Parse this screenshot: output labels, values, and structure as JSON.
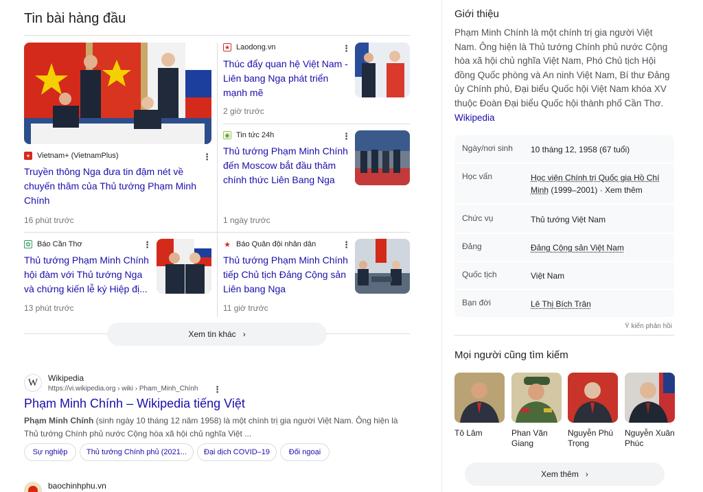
{
  "top_stories": {
    "heading": "Tin bài hàng đầu",
    "featured": {
      "source": "Vietnam+ (VietnamPlus)",
      "headline": "Truyền thông Nga đưa tin đậm nét về chuyến thăm của Thủ tướng Phạm Minh Chính",
      "time": "16 phút trước"
    },
    "stories": [
      {
        "source": "Laodong.vn",
        "headline": "Thúc đẩy quan hệ Việt Nam - Liên bang Nga phát triển mạnh mẽ",
        "time": "2 giờ trước"
      },
      {
        "source": "Tin tức 24h",
        "headline": "Thủ tướng Phạm Minh Chính đến Moscow bắt đầu thăm chính thức Liên Bang Nga",
        "time": "1 ngày trước"
      },
      {
        "source": "Báo Cần Thơ",
        "headline": "Thủ tướng Phạm Minh Chính hội đàm với Thủ tướng Nga và chứng kiến lễ ký Hiệp đị...",
        "time": "13 phút trước"
      },
      {
        "source": "Báo Quân đội nhân dân",
        "headline": "Thủ tướng Phạm Minh Chính tiếp Chủ tịch Đảng Cộng sản Liên bang Nga",
        "time": "11 giờ trước"
      }
    ],
    "more_label": "Xem tin khác",
    "more_chevron": "›"
  },
  "result_wiki": {
    "site": "Wikipedia",
    "url": "https://vi.wikipedia.org › wiki › Pham_Minh_Chính",
    "title": "Phạm Minh Chính – Wikipedia tiếng Việt",
    "snippet_bold": "Phạm Minh Chính",
    "snippet_rest": " (sinh ngày 10 tháng 12 năm 1958) là một chính trị gia người Việt Nam. Ông hiện là Thủ tướng Chính phủ nước Cộng hòa xã hội chủ nghĩa Việt ...",
    "chips": [
      "Sự nghiệp",
      "Thủ tướng Chính phủ (2021...",
      "Đại dịch COVID–19",
      "Đối ngoại"
    ]
  },
  "result_next": {
    "site": "baochinhphu.vn"
  },
  "knowledge_panel": {
    "about_heading": "Giới thiệu",
    "about_text": "Phạm Minh Chính là một chính trị gia người Việt Nam. Ông hiện là Thủ tướng Chính phủ nước Cộng hòa xã hội chủ nghĩa Việt Nam, Phó Chủ tịch Hội đồng Quốc phòng và An ninh Việt Nam, Bí thư Đảng ủy Chính phủ, Đại biểu Quốc hội Việt Nam khóa XV thuộc Đoàn Đại biểu Quốc hội thành phố Cần Thơ.",
    "about_link": "Wikipedia",
    "facts": [
      {
        "key": "Ngày/nơi sinh",
        "value": "10 tháng 12, 1958 (67 tuổi)"
      },
      {
        "key": "Học vấn",
        "value_link": "Học viện Chính trị Quốc gia Hồ Chí Minh",
        "value_rest": " (1999–2001) · Xem thêm"
      },
      {
        "key": "Chức vụ",
        "value": "Thủ tướng Việt Nam"
      },
      {
        "key": "Đảng",
        "value_link": "Đảng Cộng sản Việt Nam"
      },
      {
        "key": "Quốc tịch",
        "value": "Việt Nam"
      },
      {
        "key": "Bạn đời",
        "value_link": "Lê Thị Bích Trân"
      }
    ],
    "feedback": "Ý kiến phản hồi",
    "people_heading": "Mọi người cũng tìm kiếm",
    "people": [
      "Tô Lâm",
      "Phan Văn Giang",
      "Nguyễn Phú Trọng",
      "Nguyễn Xuân Phúc"
    ],
    "see_more": "Xem thêm",
    "see_more_chevron": "›"
  },
  "ui": {
    "kebab": "⋮"
  },
  "colors": {
    "link": "#1a0dab",
    "muted": "#70757a",
    "panel_bg": "#f8f9fa"
  }
}
